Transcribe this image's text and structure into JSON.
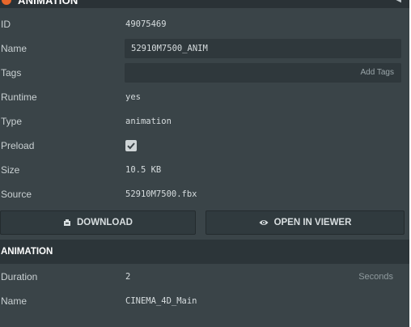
{
  "header": {
    "title": "ANIMATION"
  },
  "fields": {
    "id": {
      "label": "ID",
      "value": "49075469"
    },
    "name": {
      "label": "Name",
      "value": "52910M7500_ANIM"
    },
    "tags": {
      "label": "Tags",
      "add_label": "Add Tags"
    },
    "runtime": {
      "label": "Runtime",
      "value": "yes"
    },
    "type": {
      "label": "Type",
      "value": "animation"
    },
    "preload": {
      "label": "Preload",
      "checked": true
    },
    "size": {
      "label": "Size",
      "value": "10.5 KB"
    },
    "source": {
      "label": "Source",
      "value": "52910M7500.fbx"
    }
  },
  "actions": {
    "download": "DOWNLOAD",
    "open_viewer": "OPEN IN VIEWER"
  },
  "animation": {
    "title": "ANIMATION",
    "duration": {
      "label": "Duration",
      "value": "2",
      "unit": "Seconds"
    },
    "name": {
      "label": "Name",
      "value": "CINEMA_4D_Main"
    }
  },
  "colors": {
    "accent": "#e8672b",
    "background": "#3a4448",
    "input_bg": "#2f383c"
  },
  "icons": [
    "chevron-left-icon",
    "download-icon",
    "eye-icon",
    "check-icon"
  ]
}
